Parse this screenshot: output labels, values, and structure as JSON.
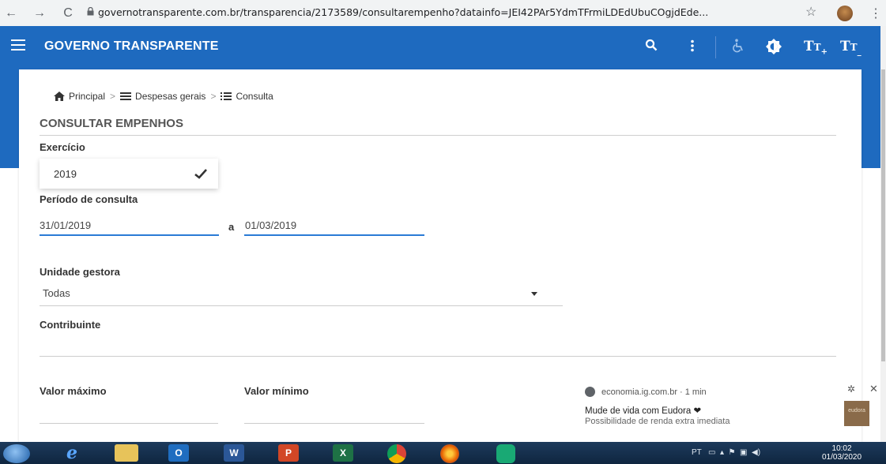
{
  "browser": {
    "back_icon": "←",
    "forward_icon": "→",
    "reload_icon": "C",
    "url": "governotransparente.com.br/transparencia/2173589/consultarempenho?datainfo=JEI42PAr5YdmTFrmiLDEdUbuCOgjdEde...",
    "star_icon": "☆",
    "menu_icon": "⋮"
  },
  "header": {
    "title": "GOVERNO TRANSPARENTE",
    "search_icon": "🔍",
    "more_icon": "⋮",
    "accessibility_icon": "♿",
    "contrast_icon": "◐",
    "font_increase": "Tт",
    "font_decrease": "Tт"
  },
  "breadcrumb": {
    "items": [
      "Principal",
      "Despesas gerais",
      "Consulta"
    ],
    "separator": ">"
  },
  "page": {
    "title": "CONSULTAR EMPENHOS"
  },
  "form": {
    "exercicio_label": "Exercício",
    "exercicio_value": "2019",
    "periodo_label": "Período de consulta",
    "periodo_start": "31/01/2019",
    "periodo_sep": "a",
    "periodo_end": "01/03/2019",
    "unidade_label": "Unidade gestora",
    "unidade_value": "Todas",
    "contribuinte_label": "Contribuinte",
    "contribuinte_value": "",
    "valor_max_label": "Valor máximo",
    "valor_min_label": "Valor mínimo"
  },
  "ad": {
    "source": "economia.ig.com.br · 1 min",
    "title": "Mude de vida com Eudora ❤",
    "subtitle": "Possibilidade de renda extra imediata",
    "thumb_text": "eudora",
    "close_icon": "✕",
    "gear_icon": "✲"
  },
  "taskbar": {
    "apps": [
      "Internet Explorer",
      "File Explorer",
      "Outlook",
      "Word",
      "PowerPoint",
      "Excel",
      "Chrome",
      "Firefox",
      "Security"
    ],
    "word_letter": "W",
    "ppt_letter": "P",
    "excel_letter": "X",
    "outlook_letter": "O",
    "ie_letter": "e",
    "language": "PT",
    "time": "10:02",
    "date": "01/03/2020"
  },
  "colors": {
    "header_blue": "#1e6abf",
    "focus_blue": "#2a7bd5"
  }
}
